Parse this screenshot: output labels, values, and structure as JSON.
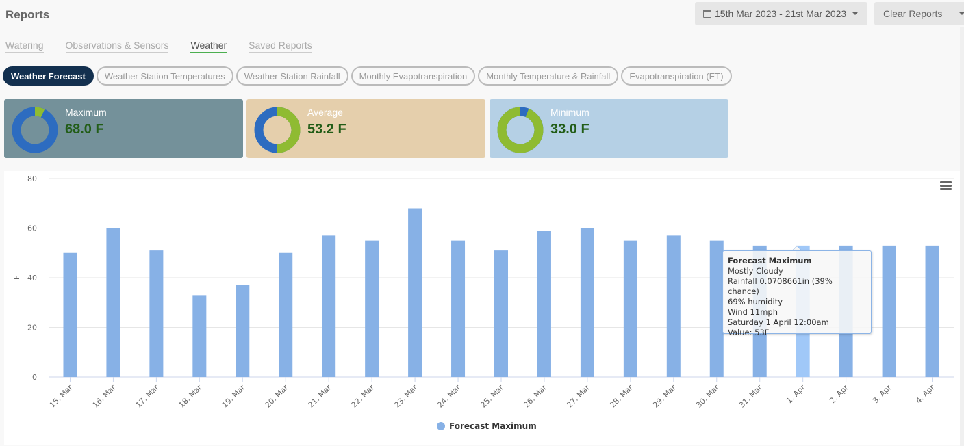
{
  "header": {
    "title": "Reports",
    "date_range_label": "15th Mar 2023 - 21st Mar 2023",
    "date_icon": "calendar-icon",
    "clear_label": "Clear Reports"
  },
  "tabs": [
    {
      "label": "Watering",
      "active": false
    },
    {
      "label": "Observations & Sensors",
      "active": false
    },
    {
      "label": "Weather",
      "active": true
    },
    {
      "label": "Saved Reports",
      "active": false
    }
  ],
  "subtabs": [
    {
      "label": "Weather Forecast",
      "active": true
    },
    {
      "label": "Weather Station Temperatures",
      "active": false
    },
    {
      "label": "Weather Station Rainfall",
      "active": false
    },
    {
      "label": "Monthly Evapotranspiration",
      "active": false
    },
    {
      "label": "Monthly Temperature & Rainfall",
      "active": false
    },
    {
      "label": "Evapotranspiration (ET)",
      "active": false
    }
  ],
  "stats": [
    {
      "label": "Maximum",
      "value": "68.0 F",
      "bg": "#74919a",
      "donut_green_fraction": 0.07,
      "donut_green_first": true
    },
    {
      "label": "Average",
      "value": "53.2 F",
      "bg": "#e5cfac",
      "donut_green_fraction": 0.5,
      "donut_green_first": true
    },
    {
      "label": "Minimum",
      "value": "33.0 F",
      "bg": "#b5d0e5",
      "donut_green_fraction": 0.94,
      "donut_green_first": false
    }
  ],
  "colors": {
    "donut_blue": "#2d6cc0",
    "donut_green": "#8fbb32",
    "bar": "#87b1e6",
    "bar_hover": "#a0c8f8",
    "stat_value": "#225d17"
  },
  "tooltip": {
    "title": "Forecast Maximum",
    "lines": [
      "Mostly Cloudy",
      "Rainfall 0.0708661in (39% chance)",
      "69% humidity",
      "Wind 11mph",
      "Saturday 1 April 12:00am",
      "Value: 53F"
    ]
  },
  "chart_data": {
    "type": "bar",
    "title": "",
    "xlabel": "",
    "ylabel": "F",
    "ylim": [
      0,
      80
    ],
    "yticks": [
      0,
      20,
      40,
      60,
      80
    ],
    "grid": true,
    "legend": "bottom-center",
    "categories": [
      "15. Mar",
      "16. Mar",
      "17. Mar",
      "18. Mar",
      "19. Mar",
      "20. Mar",
      "21. Mar",
      "22. Mar",
      "23. Mar",
      "24. Mar",
      "25. Mar",
      "26. Mar",
      "27. Mar",
      "28. Mar",
      "29. Mar",
      "30. Mar",
      "31. Mar",
      "1. Apr",
      "2. Apr",
      "3. Apr",
      "4. Apr"
    ],
    "series": [
      {
        "name": "Forecast Maximum",
        "values": [
          50,
          60,
          51,
          33,
          37,
          50,
          57,
          55,
          68,
          55,
          51,
          59,
          60,
          55,
          57,
          55,
          53,
          53,
          53,
          53,
          53
        ]
      }
    ],
    "highlighted_index": 17
  }
}
